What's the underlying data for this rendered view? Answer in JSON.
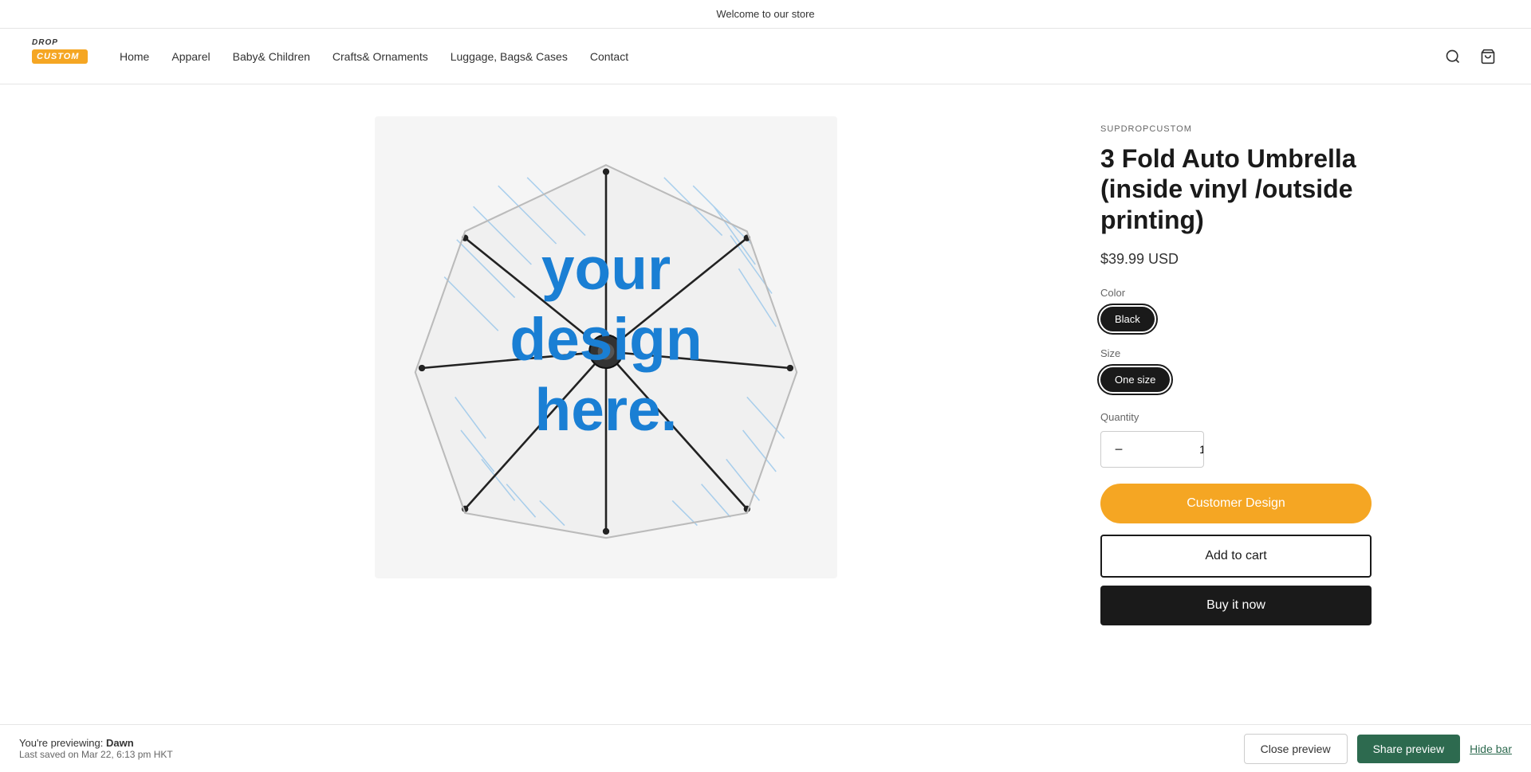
{
  "announcement": {
    "text": "Welcome to our store"
  },
  "header": {
    "logo": {
      "drop": "Drop",
      "custom": "CUSTOM"
    },
    "nav": [
      {
        "label": "Home",
        "id": "home"
      },
      {
        "label": "Apparel",
        "id": "apparel"
      },
      {
        "label": "Baby& Children",
        "id": "baby-children"
      },
      {
        "label": "Crafts& Ornaments",
        "id": "crafts-ornaments"
      },
      {
        "label": "Luggage, Bags& Cases",
        "id": "luggage"
      },
      {
        "label": "Contact",
        "id": "contact"
      }
    ]
  },
  "product": {
    "brand": "SUPDROPCUSTOM",
    "title": "3 Fold Auto Umbrella (inside vinyl /outside printing)",
    "price": "$39.99 USD",
    "color_label": "Color",
    "colors": [
      {
        "label": "Black",
        "value": "black",
        "active": true
      }
    ],
    "size_label": "Size",
    "sizes": [
      {
        "label": "One size",
        "value": "one-size",
        "active": true
      }
    ],
    "quantity_label": "Quantity",
    "quantity_value": "1",
    "buttons": {
      "customer_design": "Customer Design",
      "add_to_cart": "Add to cart",
      "buy_now": "Buy it now"
    }
  },
  "preview_bar": {
    "previewing_label": "You're previewing:",
    "theme_name": "Dawn",
    "saved_label": "Last saved on Mar 22, 6:13 pm HKT",
    "close_label": "Close preview",
    "share_label": "Share preview",
    "hide_label": "Hide bar"
  }
}
